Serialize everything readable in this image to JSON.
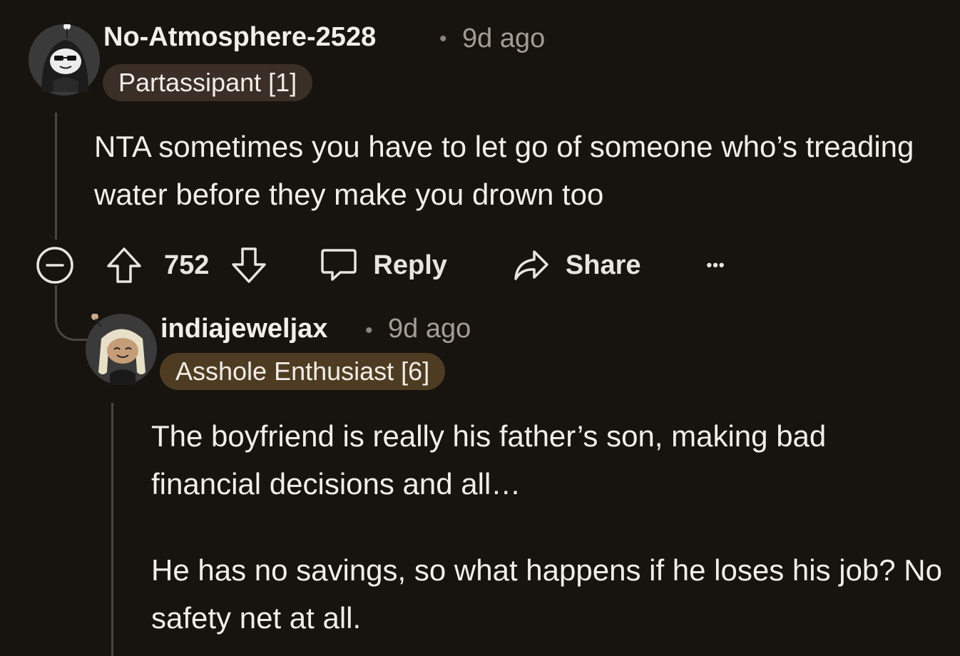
{
  "comments": [
    {
      "username": "No-Atmosphere-2528",
      "separator": "•",
      "time": "9d ago",
      "flair": "Partassipant [1]",
      "flair_color": "#3a2e27",
      "body": "NTA sometimes you have to let go of someone who’s treading water before they make you drown too",
      "votes": "752",
      "actions": {
        "reply": "Reply",
        "share": "Share",
        "more": "•••"
      }
    },
    {
      "username": "indiajeweljax",
      "separator": "•",
      "time": "9d ago",
      "flair": "Asshole Enthusiast [6]",
      "flair_color": "#4e3c22",
      "body_paragraphs": [
        "The boyfriend is really his father’s son, making bad financial decisions and all…",
        "He has no savings, so what happens if he loses his job? No safety net at all."
      ]
    }
  ],
  "colors": {
    "background": "#17130f",
    "thread_line": "#4a4540",
    "text_primary": "#f2efeb",
    "text_muted": "#a49d95"
  },
  "icons": {
    "collapse": "collapse-minus-icon",
    "upvote": "upvote-arrow-icon",
    "downvote": "downvote-arrow-icon",
    "reply": "speech-bubble-icon",
    "share": "share-arrow-icon",
    "more": "more-dots-icon"
  }
}
